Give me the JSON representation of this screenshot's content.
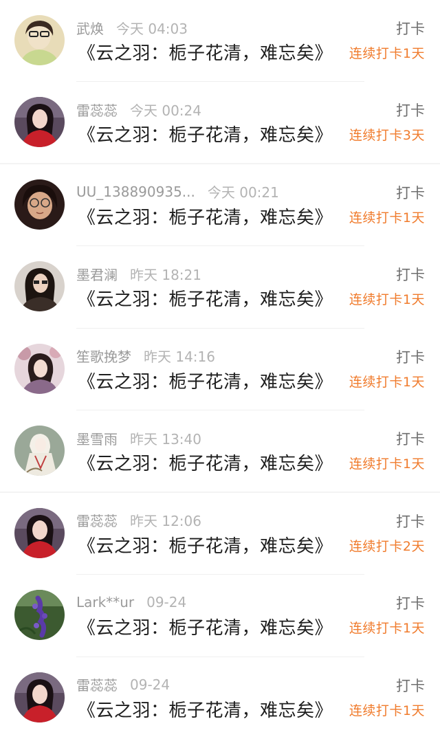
{
  "checkin_label": "打卡",
  "entries": [
    {
      "username": "武焕",
      "time": "今天 04:03",
      "title": "《云之羽：栀子花清，难忘矣》",
      "streak": "连续打卡1天",
      "avatar": "avatar-photo-icon"
    },
    {
      "username": "雷蕊蕊",
      "time": "今天 00:24",
      "title": "《云之羽：栀子花清，难忘矣》",
      "streak": "连续打卡3天",
      "avatar": "avatar-photo-icon"
    },
    {
      "username": "UU_138890935...",
      "time": "今天 00:21",
      "title": "《云之羽：栀子花清，难忘矣》",
      "streak": "连续打卡1天",
      "avatar": "avatar-photo-icon"
    },
    {
      "username": "墨君澜",
      "time": "昨天 18:21",
      "title": "《云之羽：栀子花清，难忘矣》",
      "streak": "连续打卡1天",
      "avatar": "avatar-photo-icon"
    },
    {
      "username": "笙歌挽梦",
      "time": "昨天 14:16",
      "title": "《云之羽：栀子花清，难忘矣》",
      "streak": "连续打卡1天",
      "avatar": "avatar-photo-icon"
    },
    {
      "username": "墨雪雨",
      "time": "昨天 13:40",
      "title": "《云之羽：栀子花清，难忘矣》",
      "streak": "连续打卡1天",
      "avatar": "avatar-photo-icon"
    },
    {
      "username": "雷蕊蕊",
      "time": "昨天 12:06",
      "title": "《云之羽：栀子花清，难忘矣》",
      "streak": "连续打卡2天",
      "avatar": "avatar-photo-icon"
    },
    {
      "username": "Lark**ur",
      "time": "09-24",
      "title": "《云之羽：栀子花清，难忘矣》",
      "streak": "连续打卡1天",
      "avatar": "avatar-photo-icon"
    },
    {
      "username": "雷蕊蕊",
      "time": "09-24",
      "title": "《云之羽：栀子花清，难忘矣》",
      "streak": "连续打卡1天",
      "avatar": "avatar-photo-icon"
    }
  ],
  "colors": {
    "streak": "#f07b2c",
    "username": "#9a9a9a",
    "timestamp": "#b3b3b3",
    "checkin": "#6e6e6e",
    "title": "#1e1e1e"
  }
}
